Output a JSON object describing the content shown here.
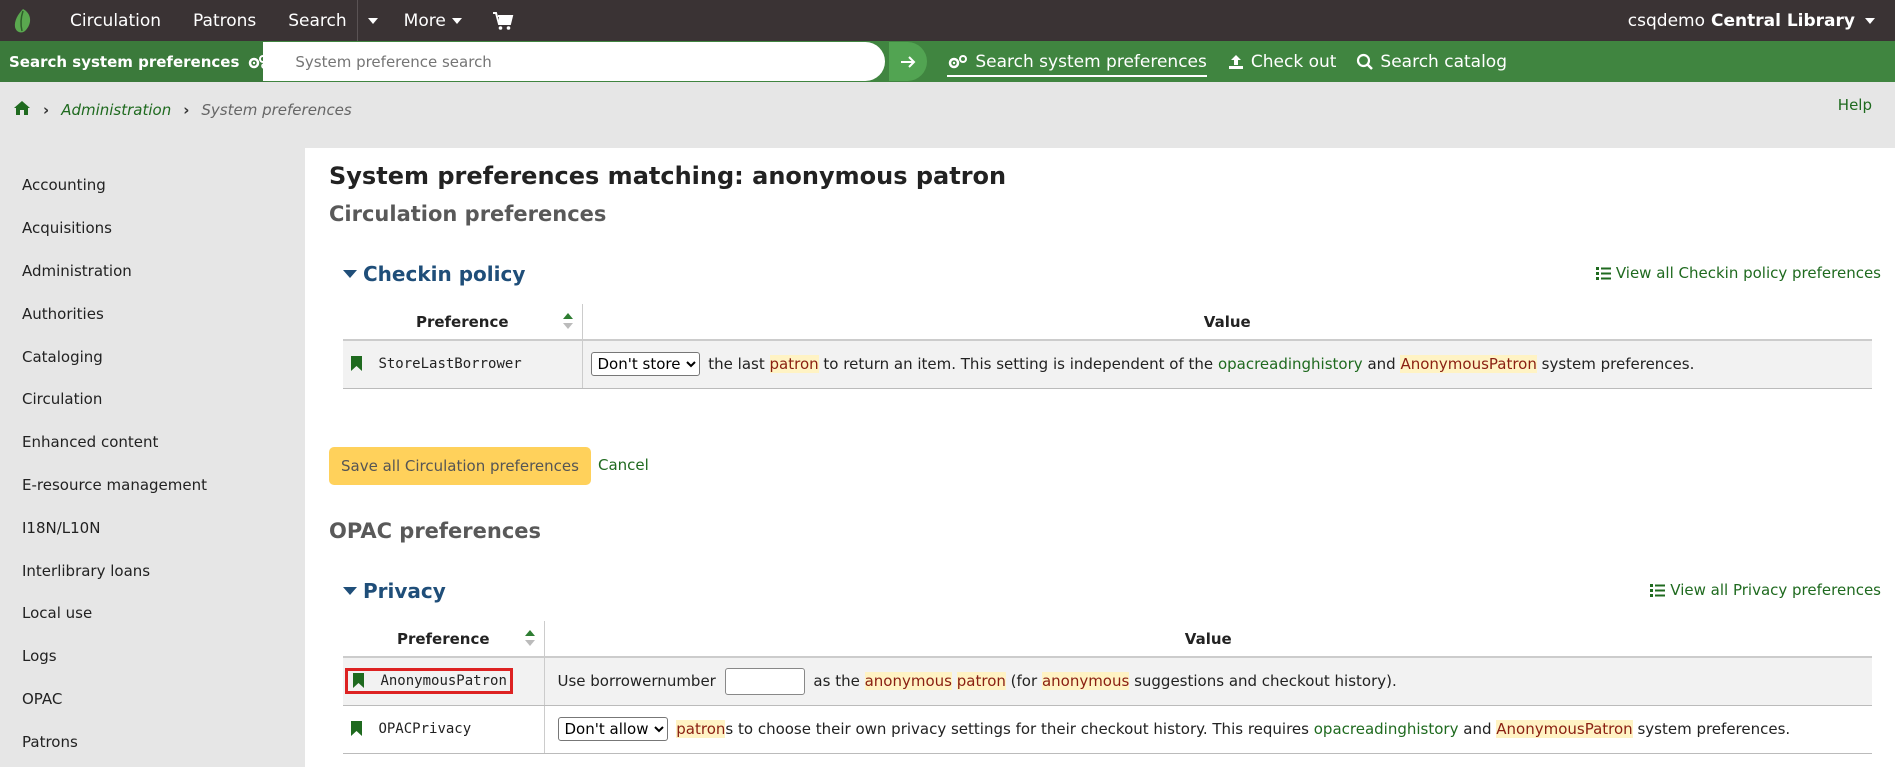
{
  "nav": {
    "items": [
      "Circulation",
      "Patrons",
      "Search",
      "More"
    ],
    "user": "csqdemo",
    "library": "Central Library"
  },
  "search": {
    "label": "Search system preferences",
    "placeholder": "System preference search",
    "tools": [
      "Search system preferences",
      "Check out",
      "Search catalog"
    ]
  },
  "breadcrumb": {
    "admin": "Administration",
    "current": "System preferences",
    "help": "Help"
  },
  "sidebar": {
    "items": [
      "Accounting",
      "Acquisitions",
      "Administration",
      "Authorities",
      "Cataloging",
      "Circulation",
      "Enhanced content",
      "E-resource management",
      "I18N/L10N",
      "Interlibrary loans",
      "Local use",
      "Logs",
      "OPAC",
      "Patrons"
    ]
  },
  "main": {
    "title": "System preferences matching: anonymous patron",
    "circ_section": "Circulation preferences",
    "opac_section": "OPAC preferences",
    "checkin": {
      "heading": "Checkin policy",
      "view_all": "View all Checkin policy preferences",
      "col_pref": "Preference",
      "col_value": "Value",
      "row_name": "StoreLastBorrower",
      "select_value": "Don't store",
      "t1": "the last",
      "t_patron": "patron",
      "t2": "to return an item. This setting is independent of the",
      "link1": "opacreadinghistory",
      "t3": "and",
      "link2": "AnonymousPatron",
      "t4": "system preferences."
    },
    "save_label": "Save all Circulation preferences",
    "cancel_label": "Cancel",
    "privacy": {
      "heading": "Privacy",
      "view_all": "View all Privacy preferences",
      "col_pref": "Preference",
      "col_value": "Value",
      "row1_name": "AnonymousPatron",
      "r1_t1": "Use borrowernumber",
      "r1_t2": "as the",
      "r1_anon": "anonymous",
      "r1_patron": "patron",
      "r1_t3": "(for",
      "r1_anon2": "anonymous",
      "r1_t4": "suggestions and checkout history).",
      "row2_name": "OPACPrivacy",
      "r2_select": "Don't allow",
      "r2_patron": "patron",
      "r2_t1": "s to choose their own privacy settings for their checkout history. This requires",
      "r2_link1": "opacreadinghistory",
      "r2_t2": "and",
      "r2_link2": "AnonymousPatron",
      "r2_t3": "system preferences."
    }
  }
}
